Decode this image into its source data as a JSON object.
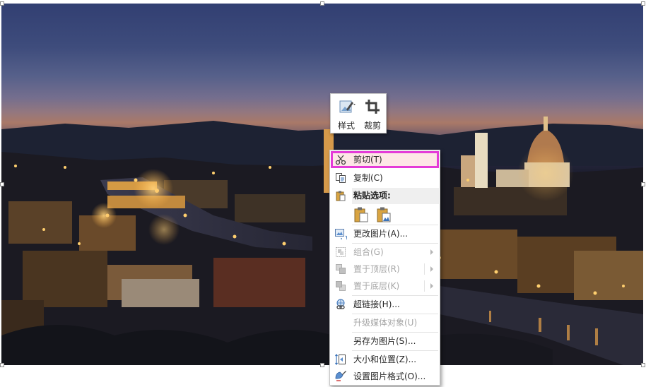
{
  "mini_toolbar": {
    "style_label": "样式",
    "crop_label": "裁剪"
  },
  "context_menu": {
    "cut": "剪切(T)",
    "copy": "复制(C)",
    "paste_options_header": "粘贴选项:",
    "change_picture": "更改图片(A)...",
    "group": "组合(G)",
    "bring_to_front": "置于顶层(R)",
    "send_to_back": "置于底层(K)",
    "hyperlink": "超链接(H)...",
    "upgrade_media": "升级媒体对象(U)",
    "save_as_picture": "另存为图片(S)...",
    "size_position": "大小和位置(Z)...",
    "format_picture": "设置图片格式(O)..."
  },
  "colors": {
    "highlight_border": "#e43bd8",
    "highlight_fill": "#fde6e6"
  },
  "icons": [
    "style-icon",
    "crop-icon",
    "scissors-icon",
    "copy-icon",
    "clipboard-icon",
    "paste-keep-icon",
    "paste-picture-icon",
    "change-picture-icon",
    "group-icon",
    "bring-front-icon",
    "send-back-icon",
    "hyperlink-icon",
    "size-position-icon",
    "format-picture-icon"
  ]
}
